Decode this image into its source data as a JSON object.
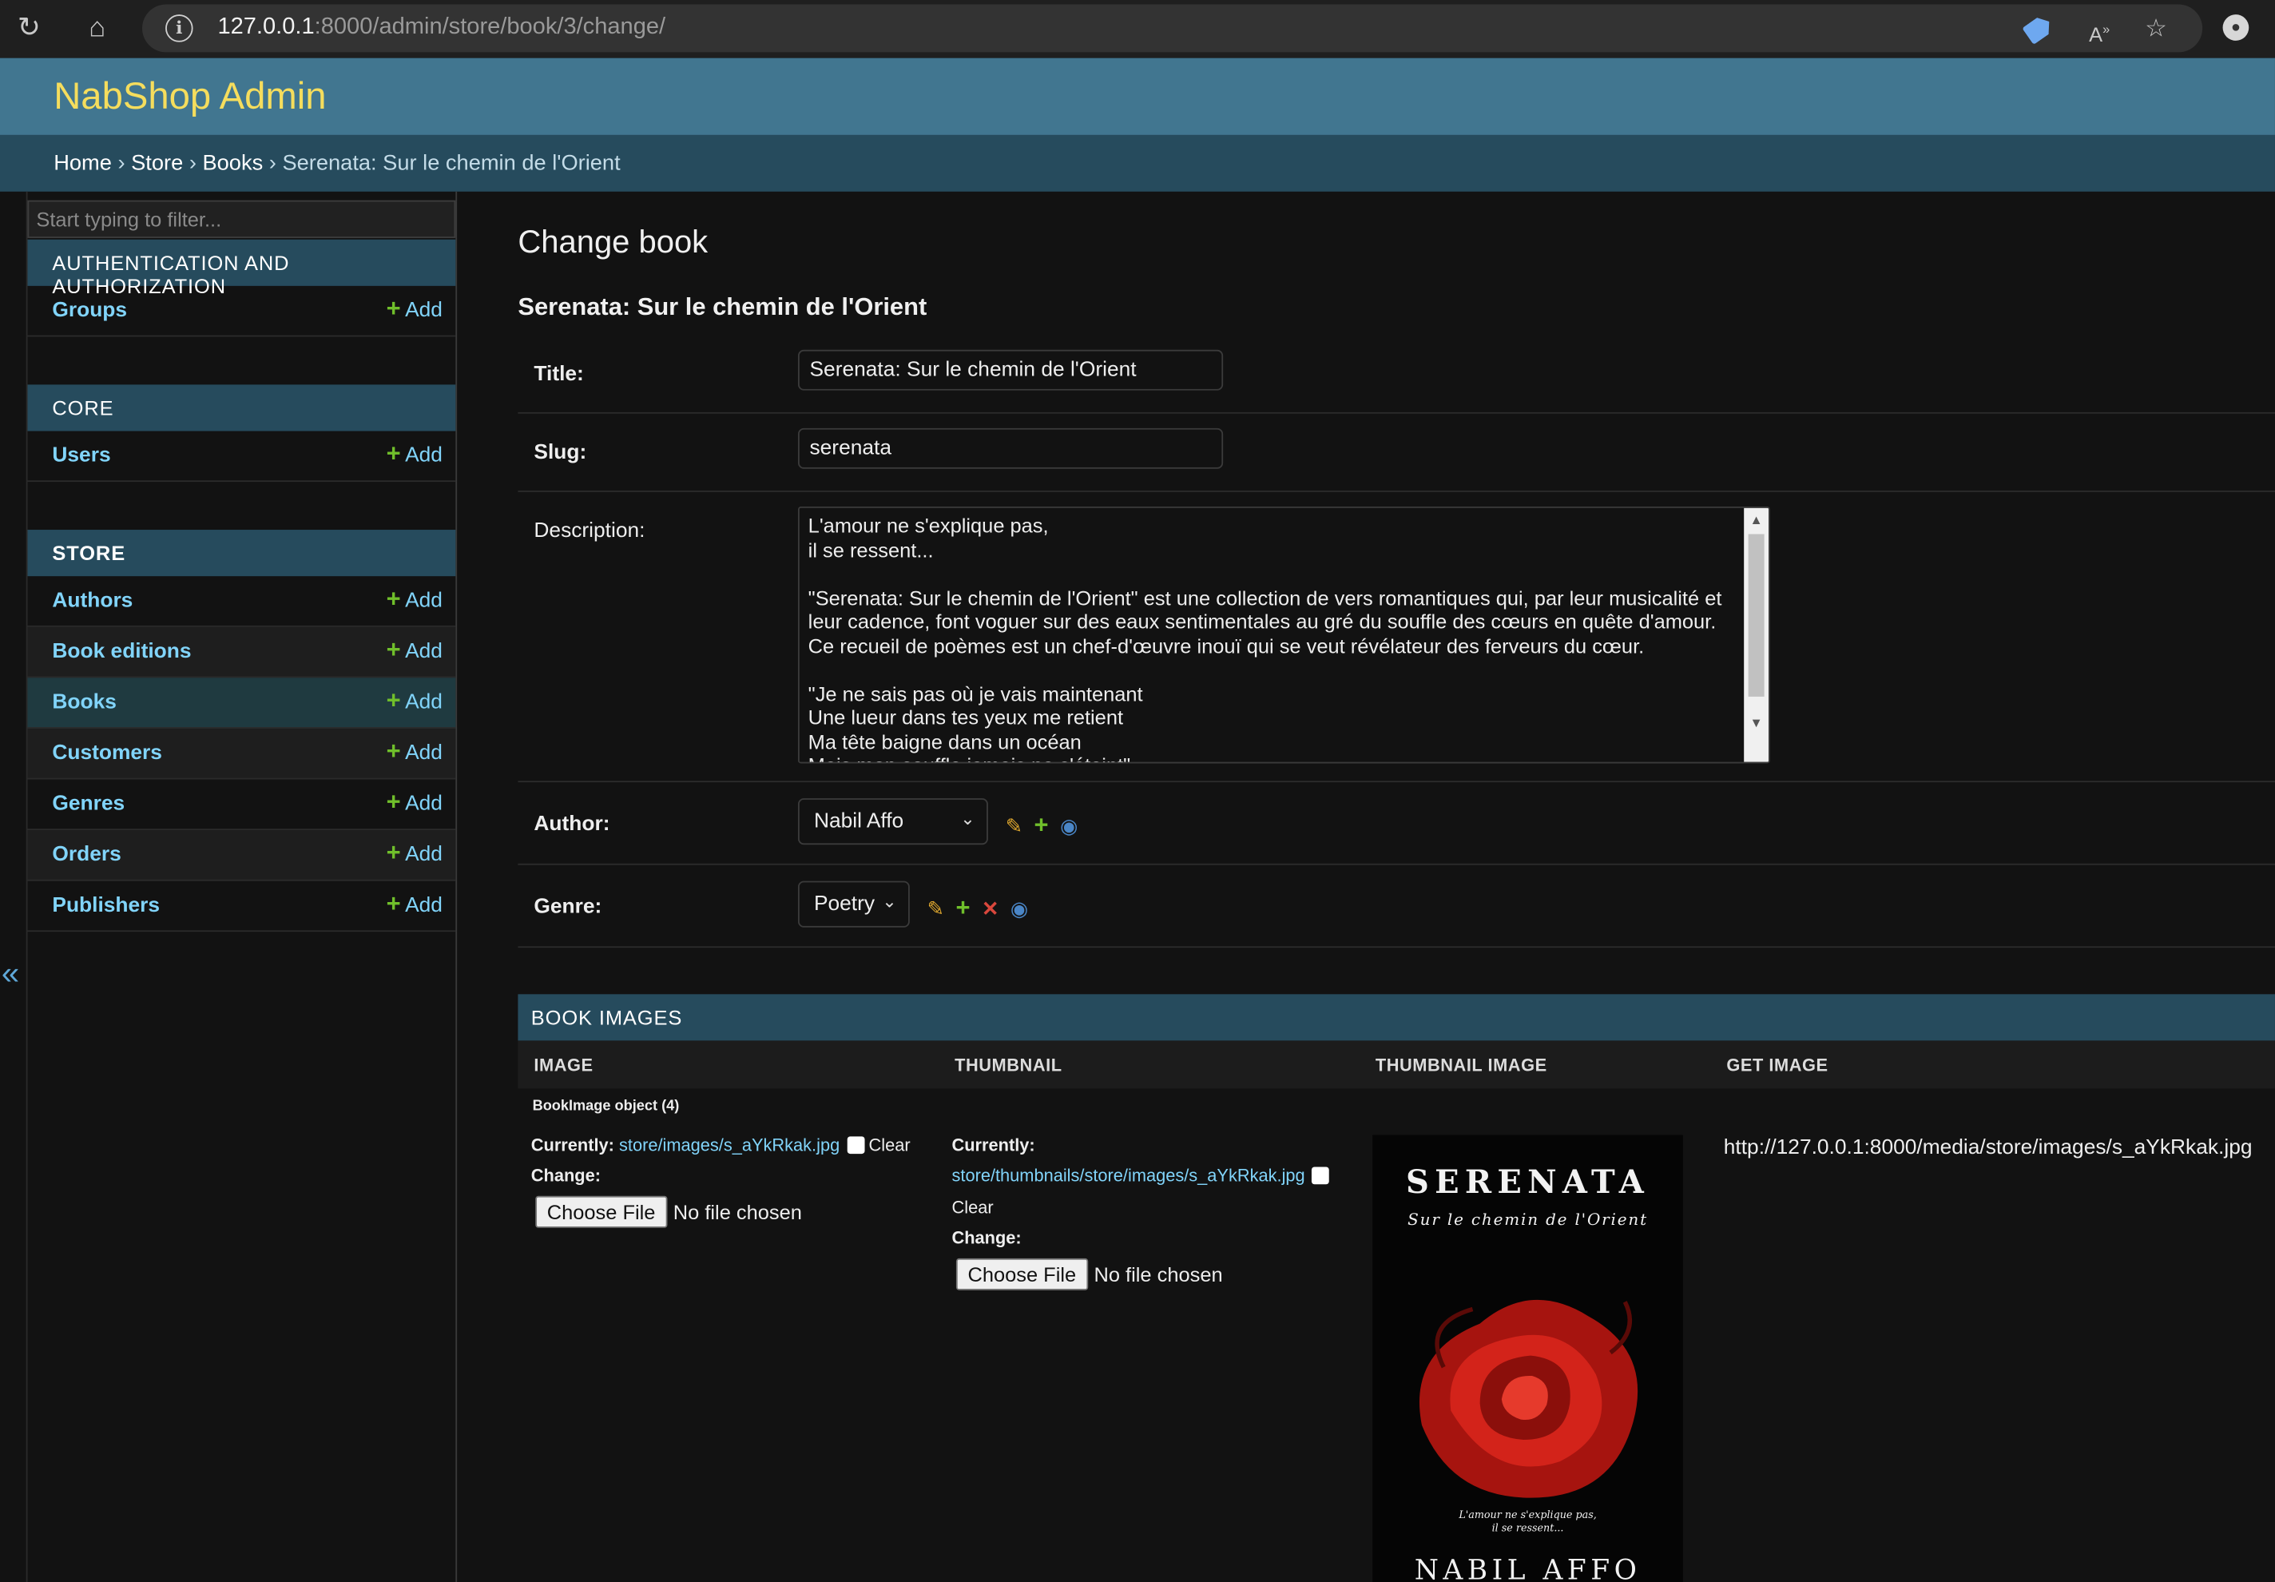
{
  "browser": {
    "url_host": "127.0.0.1",
    "url_path": ":8000/admin/store/book/3/change/"
  },
  "header": {
    "brand": "NabShop Admin"
  },
  "breadcrumbs": {
    "home": "Home",
    "store": "Store",
    "books": "Books",
    "current": "Serenata: Sur le chemin de l'Orient",
    "sep": " › "
  },
  "sidebar": {
    "filter_placeholder": "Start typing to filter...",
    "add_label": "Add",
    "collapse": "«",
    "modules": [
      {
        "caption": "AUTHENTICATION AND AUTHORIZATION",
        "models": [
          "Groups"
        ]
      },
      {
        "caption": "CORE",
        "models": [
          "Users"
        ]
      },
      {
        "caption": "STORE",
        "models": [
          "Authors",
          "Book editions",
          "Books",
          "Customers",
          "Genres",
          "Orders",
          "Publishers"
        ]
      }
    ]
  },
  "content": {
    "title": "Change book",
    "subtitle": "Serenata: Sur le chemin de l'Orient",
    "fields": {
      "title_label": "Title:",
      "title_value": "Serenata: Sur le chemin de l'Orient",
      "slug_label": "Slug:",
      "slug_value": "serenata",
      "description_label": "Description:",
      "description_value": "L'amour ne s'explique pas,\nil se ressent...\n\n\"Serenata: Sur le chemin de l'Orient\" est une collection de vers romantiques qui, par leur musicalité et leur cadence, font voguer sur des eaux sentimentales au gré du souffle des cœurs en quête d'amour.\nCe recueil de poèmes est un chef-d'œuvre inouï qui se veut révélateur des ferveurs du cœur.\n\n\"Je ne sais pas où je vais maintenant\nUne lueur dans tes yeux me retient\nMa tête baigne dans un océan\nMais mon souffle jamais ne s'éteint\"",
      "author_label": "Author:",
      "author_value": "Nabil Affo",
      "genre_label": "Genre:",
      "genre_value": "Poetry"
    },
    "inline": {
      "caption": "BOOK IMAGES",
      "columns": [
        "IMAGE",
        "THUMBNAIL",
        "THUMBNAIL IMAGE",
        "GET IMAGE"
      ],
      "object_label": "BookImage object (4)",
      "currently_label": "Currently:",
      "change_label": "Change:",
      "clear_label": "Clear",
      "image_path": "store/images/s_aYkRkak.jpg",
      "thumbnail_path": "store/thumbnails/store/images/s_aYkRkak.jpg",
      "choose_file": "Choose File",
      "no_file": "No file chosen",
      "get_image_url": "http://127.0.0.1:8000/media/store/images/s_aYkRkak.jpg",
      "cover": {
        "title": "SERENATA",
        "subtitle": "Sur le chemin de l'Orient",
        "tagline": "L'amour ne s'explique pas,\nil se ressent...",
        "author": "NABIL AFFO"
      }
    }
  },
  "colors": {
    "header": "#417690",
    "breadcrumbs": "#264b5d",
    "brand": "#f5dd5d",
    "link": "#81d4fa",
    "add_icon": "#70bf2b",
    "background": "#121212"
  },
  "icons": [
    "reload-icon",
    "home-icon",
    "info-icon",
    "tag-icon",
    "read-aloud-icon",
    "favorites-icon",
    "profile-icon",
    "pencil-icon",
    "plus-icon",
    "delete-icon",
    "eye-icon",
    "collapse-sidebar-icon",
    "chevron-down-icon"
  ]
}
